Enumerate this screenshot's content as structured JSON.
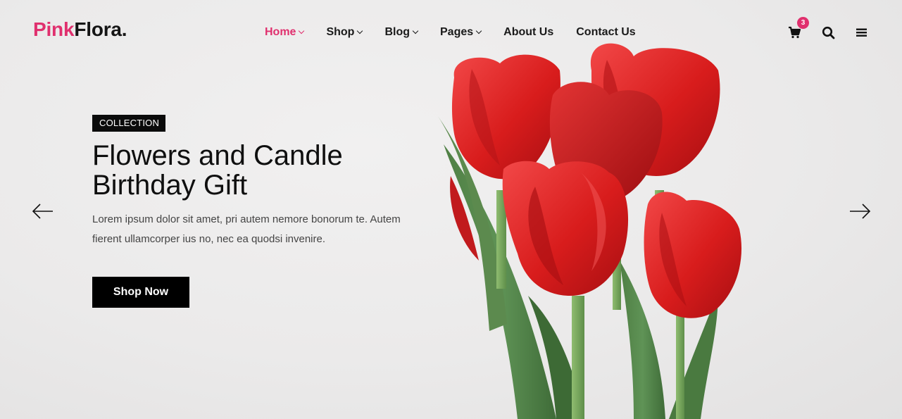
{
  "brand": {
    "part1": "Pink",
    "part2": "Flora."
  },
  "nav": {
    "items": [
      {
        "label": "Home",
        "dropdown": true,
        "active": true
      },
      {
        "label": "Shop",
        "dropdown": true,
        "active": false
      },
      {
        "label": "Blog",
        "dropdown": true,
        "active": false
      },
      {
        "label": "Pages",
        "dropdown": true,
        "active": false
      },
      {
        "label": "About Us",
        "dropdown": false,
        "active": false
      },
      {
        "label": "Contact Us",
        "dropdown": false,
        "active": false
      }
    ]
  },
  "header": {
    "cart_count": "3",
    "icons": [
      "cart-icon",
      "search-icon",
      "menu-icon"
    ]
  },
  "hero": {
    "tag": "COLLECTION",
    "title_line1": "Flowers and Candle",
    "title_line2": "Birthday Gift",
    "description": "Lorem ipsum dolor sit amet, pri autem nemore bonorum te. Autem fierent ullamcorper ius no, nec ea quodsi invenire.",
    "cta_label": "Shop Now",
    "image": "red-tulips-bouquet"
  },
  "slider": {
    "prev_icon": "arrow-left-icon",
    "next_icon": "arrow-right-icon"
  },
  "colors": {
    "accent": "#e0306e",
    "dark": "#000000",
    "background": "#ebeaea"
  }
}
